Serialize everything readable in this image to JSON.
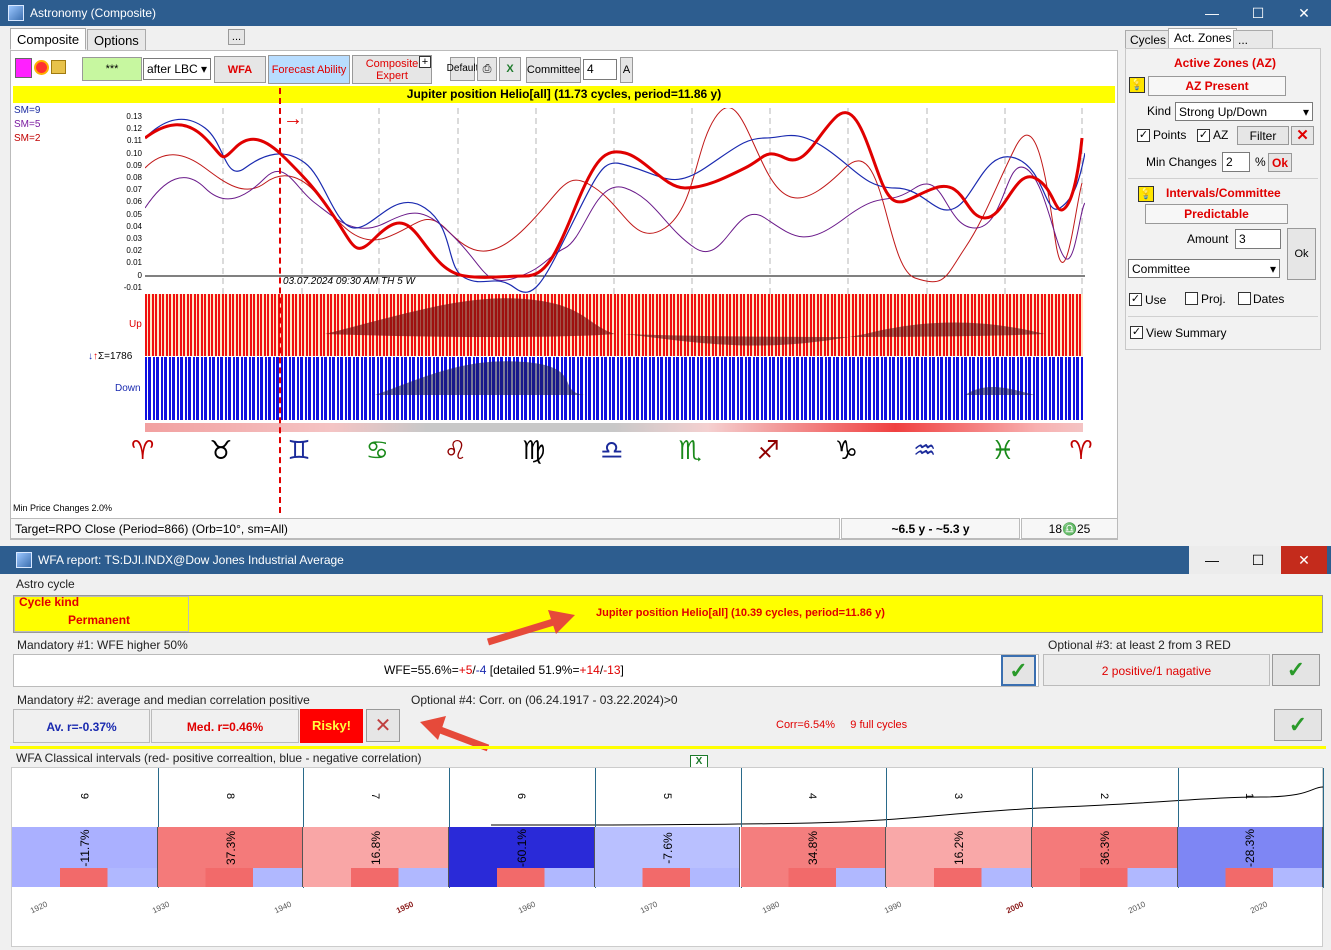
{
  "astro_window": {
    "title": "Astronomy (Composite)",
    "controls": [
      "—",
      "☐",
      "✕"
    ]
  },
  "tabs": {
    "composite": "Composite",
    "options": "Options",
    "more": "..."
  },
  "toolbar": {
    "green_box": "***",
    "after_lbc": "after LBC",
    "wfa": "WFA",
    "forecast_ability": "Forecast Ability",
    "composite_expert": "Composite Expert",
    "default": "Default",
    "committee": "Committee",
    "committee_value": "4",
    "a_button": "A"
  },
  "chart": {
    "title": "Jupiter position Helio[all]  (11.73 cycles, period=11.86 y)",
    "sm_labels": [
      "SM=9",
      "SM=5",
      "SM=2"
    ],
    "y_ticks": [
      "0.13",
      "0.12",
      "0.11",
      "0.10",
      "0.09",
      "0.08",
      "0.07",
      "0.06",
      "0.05",
      "0.04",
      "0.03",
      "0.02",
      "0.01",
      "0",
      "-0.01"
    ],
    "date_label": "03.07.2024  09:30 AM TH  5 W",
    "up_label": "Up",
    "down_label": "Down",
    "sigma_label": "Σ=1786",
    "zodiac": [
      "♈",
      "♉",
      "♊",
      "♋",
      "♌",
      "♍",
      "♎",
      "♏",
      "♐",
      "♑",
      "♒",
      "♓",
      "♈"
    ],
    "zodiac_colors": [
      "#c00000",
      "#000000",
      "#1a2a9a",
      "#1a8a1a",
      "#900000",
      "#000000",
      "#1a2a9a",
      "#1a8a1a",
      "#900000",
      "#000000",
      "#1a2a9a",
      "#1a8a1a",
      "#c00000"
    ],
    "min_price_changes": "Min Price Changes  2.0%"
  },
  "status_bar": {
    "target": "Target=RPO Close (Period=866) (Orb=10°, sm=All)",
    "range": "~6.5 y - ~5.3 y",
    "counts": "18♎25"
  },
  "side_tabs": {
    "cycles": "Cycles",
    "act_zones": "Act. Zones",
    "more": "..."
  },
  "sidebar": {
    "active_zones": "Active Zones (AZ)",
    "az_present": "AZ Present",
    "kind_label": "Kind",
    "kind_value": "Strong Up/Down",
    "points": "Points",
    "az": "AZ",
    "filter": "Filter",
    "min_changes": "Min Changes",
    "min_changes_value": "2",
    "percent": "%",
    "ok": "Ok",
    "intervals": "Intervals/Committee",
    "predictable": "Predictable",
    "amount_label": "Amount",
    "amount_value": "3",
    "committee": "Committee",
    "ok2": "Ok",
    "use": "Use",
    "proj": "Proj.",
    "dates": "Dates",
    "view_summary": "View Summary"
  },
  "wfa_window": {
    "title": "WFA report: TS:DJI.INDX@Dow Jones Industrial Average",
    "controls": [
      "—",
      "☐",
      "✕"
    ]
  },
  "wfa": {
    "astro_cycle": "Astro cycle",
    "cycle_kind": "Cycle kind",
    "permanent": "Permanent",
    "cycle_desc": "Jupiter position Helio[all]  (10.39 cycles, period=11.86 y)",
    "mandatory1_label": "Mandatory #1: WFE higher 50%",
    "wfe_prefix": "WFE=55.6%=",
    "wfe_pos": "+5",
    "wfe_sep": "/",
    "wfe_neg": "-4",
    "wfe_detail_prefix": " [detailed 51.9%=",
    "wfe_detail_pos": "+14",
    "wfe_detail_sep": "/",
    "wfe_detail_neg": "-13",
    "wfe_detail_suffix": "]",
    "optional3_label": "Optional #3: at least 2 from 3 RED",
    "optional3_value": "2 positive/1 nagative",
    "mandatory2_label": "Mandatory #2: average and median correlation  positive",
    "avg_r": "Av. r=-0.37%",
    "med_r": "Med. r=0.46%",
    "risky": "Risky!",
    "optional4_label": "Optional #4: Corr. on (06.24.1917 - 03.22.2024)>0",
    "corr": "Corr=6.54%     9 full cycles",
    "classical_label": "WFA Classical intervals (red- positive correaltion, blue - negative correlation)",
    "segments": [
      {
        "n": "9",
        "v": "-11.7%",
        "c": "#aab0ff"
      },
      {
        "n": "8",
        "v": "37.3%",
        "c": "#f47a7a"
      },
      {
        "n": "7",
        "v": "16.8%",
        "c": "#f9a6a6"
      },
      {
        "n": "6",
        "v": "-60.1%",
        "c": "#2a2ad8"
      },
      {
        "n": "5",
        "v": "-7.6%",
        "c": "#b9c0ff"
      },
      {
        "n": "4",
        "v": "34.8%",
        "c": "#f47e7e"
      },
      {
        "n": "3",
        "v": "16.2%",
        "c": "#f9a8a8"
      },
      {
        "n": "2",
        "v": "36.3%",
        "c": "#f47a7a"
      },
      {
        "n": "1",
        "v": "-28.3%",
        "c": "#7e86f4"
      }
    ],
    "years": [
      "1920",
      "1930",
      "1940",
      "1950",
      "1960",
      "1970",
      "1980",
      "1990",
      "2000",
      "2010",
      "2020"
    ]
  }
}
